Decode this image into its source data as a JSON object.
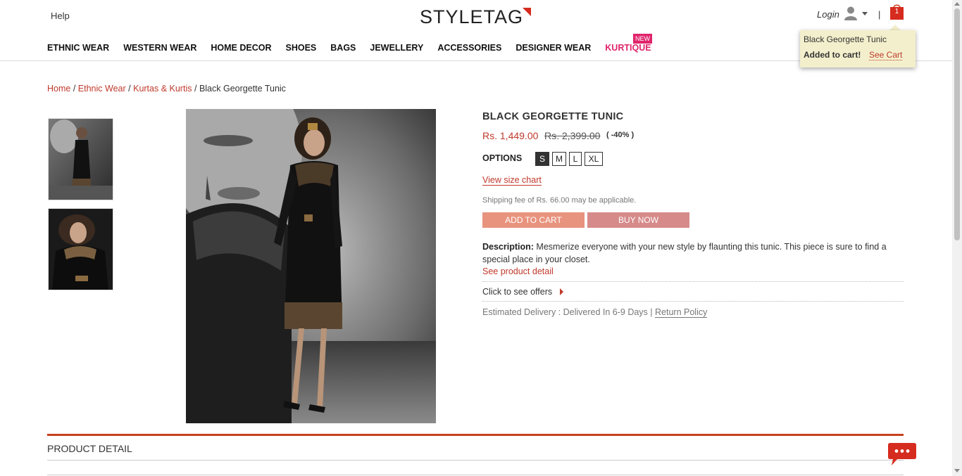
{
  "header": {
    "help": "Help",
    "logo": "STYLETAG",
    "login": "Login",
    "separator": "|",
    "cart_count": "1"
  },
  "nav": {
    "items": [
      "ETHNIC WEAR",
      "WESTERN WEAR",
      "HOME DECOR",
      "SHOES",
      "BAGS",
      "JEWELLERY",
      "ACCESSORIES",
      "DESIGNER WEAR",
      "KURTIQUE"
    ],
    "new_badge": "NEW"
  },
  "cart_popup": {
    "product": "Black Georgette Tunic",
    "added": "Added to cart!",
    "see_cart": "See Cart"
  },
  "breadcrumb": {
    "home": "Home",
    "sep": "/",
    "cat": "Ethnic Wear",
    "sub": "Kurtas & Kurtis",
    "current": "Black Georgette Tunic"
  },
  "product": {
    "name": "BLACK GEORGETTE TUNIC",
    "price": "Rs. 1,449.00",
    "mrp": "Rs. 2,399.00",
    "discount": "( -40% )",
    "options_label": "OPTIONS",
    "sizes": [
      "S",
      "M",
      "L",
      "XL"
    ],
    "selected_size": "S",
    "size_chart": "View size chart",
    "shipping": "Shipping fee of Rs. 66.00 may be applicable.",
    "add_to_cart": "ADD TO CART",
    "buy_now": "BUY NOW",
    "description_label": "Description:",
    "description": "Mesmerize everyone with your new style by flaunting this tunic. This piece is sure to find a special place in your closet.",
    "see_detail": "See product detail",
    "offers": "Click to see offers",
    "delivery": "Estimated Delivery : Delivered In 6-9 Days |",
    "return_policy": "Return Policy"
  },
  "section": {
    "product_detail": "PRODUCT DETAIL"
  },
  "colors": {
    "accent": "#c0392b",
    "kurtique": "#e0246b",
    "add_btn": "#e8937e",
    "buy_btn": "#d68a8a"
  }
}
